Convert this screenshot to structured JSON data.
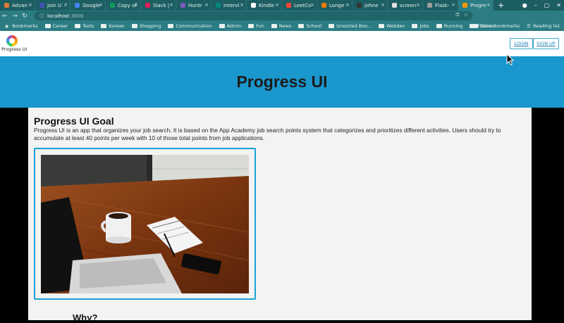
{
  "browser": {
    "tabs": [
      {
        "label": "Advan",
        "color": "#e07b39"
      },
      {
        "label": "Join U",
        "color": "#3f51b5"
      },
      {
        "label": "Google",
        "color": "#4285f4"
      },
      {
        "label": "Copy of",
        "color": "#0f9d58"
      },
      {
        "label": "Slack |",
        "color": "#e01e5a"
      },
      {
        "label": "Huntr",
        "color": "#7e57c2"
      },
      {
        "label": "Intervi",
        "color": "#00897b"
      },
      {
        "label": "Kindle",
        "color": "#ffffff"
      },
      {
        "label": "LeetCo",
        "color": "#f44336"
      },
      {
        "label": "Longe",
        "color": "#f57c00"
      },
      {
        "label": "johne",
        "color": "#333333"
      },
      {
        "label": "screen",
        "color": "#e0e0e0"
      },
      {
        "label": "Flask-",
        "color": "#9e9e9e"
      },
      {
        "label": "Progre",
        "color": "#ff9800"
      }
    ],
    "new_tab": "+",
    "url_host": "localhost",
    "url_port": ":3000",
    "bookmarks_label": "Bookmarks",
    "bookmark_folders": [
      "Career",
      "Tools",
      "Korean",
      "Shopping",
      "Communication",
      "Admin",
      "Fun",
      "News",
      "School",
      "Unsorted Boo...",
      "Webdev",
      "Jobs",
      "Running",
      "Finance"
    ],
    "other_bookmarks": "Other bookmarks",
    "reading_list": "Reading list"
  },
  "app": {
    "logo_text": "Progress UI",
    "login": "LOGIN",
    "signup": "SIGN UP",
    "hero_title": "Progress UI",
    "goal_title": "Progress UI Goal",
    "goal_text": "Progress UI is an app that organizes your job search. It is based on the App Academy job search points system that categorizes and prioritizes different activities. Users should try to accumulate at least 40 points per week with 10 of those total points from job applications.",
    "why_title": "Why?"
  }
}
